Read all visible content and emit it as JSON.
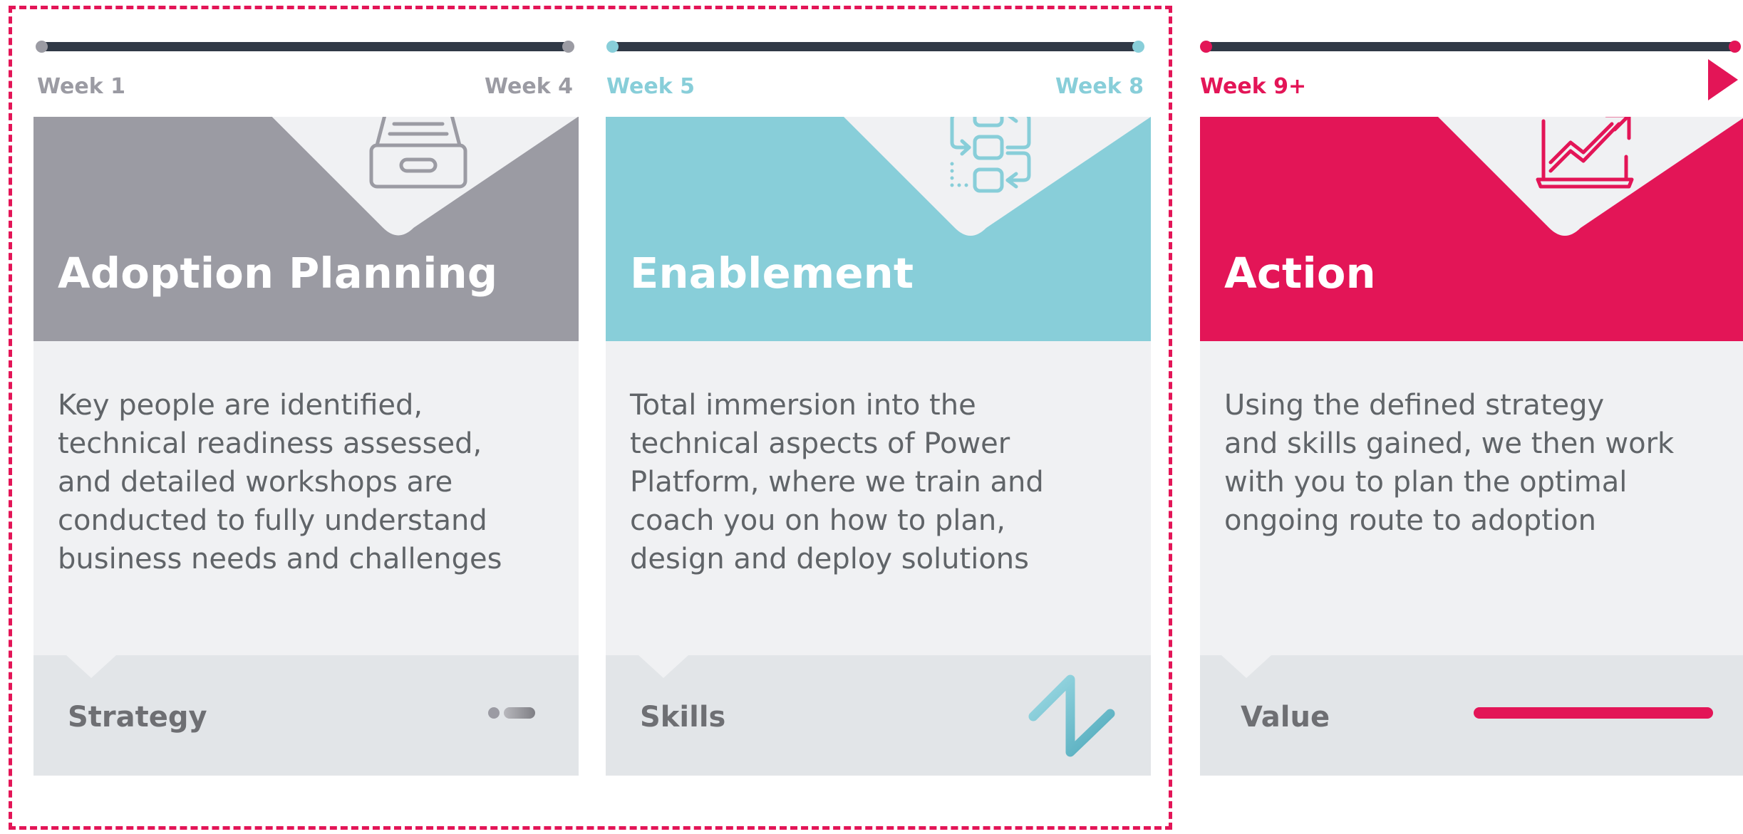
{
  "colors": {
    "adoption": "#9b9ba3",
    "enablement": "#88ced9",
    "action": "#e31557",
    "track": "#303946",
    "card_body_bg": "#f0f1f3",
    "card_foot_bg": "#e2e5e8",
    "body_text": "#606468",
    "frame_dash": "#e31557"
  },
  "phases": [
    {
      "week_start": "Week 1",
      "week_end": "Week 4",
      "title": "Adoption Planning",
      "description": "Key people are identified,\ntechnical readiness assessed,\nand detailed workshops are\nconducted to fully understand\nbusiness needs and challenges",
      "footer_label": "Strategy",
      "icon": "archive-drawer-icon",
      "footer_graphic": "toggle-pill-icon"
    },
    {
      "week_start": "Week 5",
      "week_end": "Week 8",
      "title": "Enablement",
      "description": "Total immersion into the\ntechnical aspects of Power\nPlatform, where we train and\ncoach you on how to plan,\ndesign and deploy solutions",
      "footer_label": "Skills",
      "icon": "workflow-blocks-icon",
      "footer_graphic": "zigzag-icon"
    },
    {
      "week_start": "Week 9+",
      "title": "Action",
      "description": "Using the defined strategy\nand skills gained, we then work\nwith you to plan the optimal\nongoing route to adoption",
      "footer_label": "Value",
      "icon": "laptop-growth-chart-icon",
      "footer_graphic": "value-bar-icon"
    }
  ]
}
